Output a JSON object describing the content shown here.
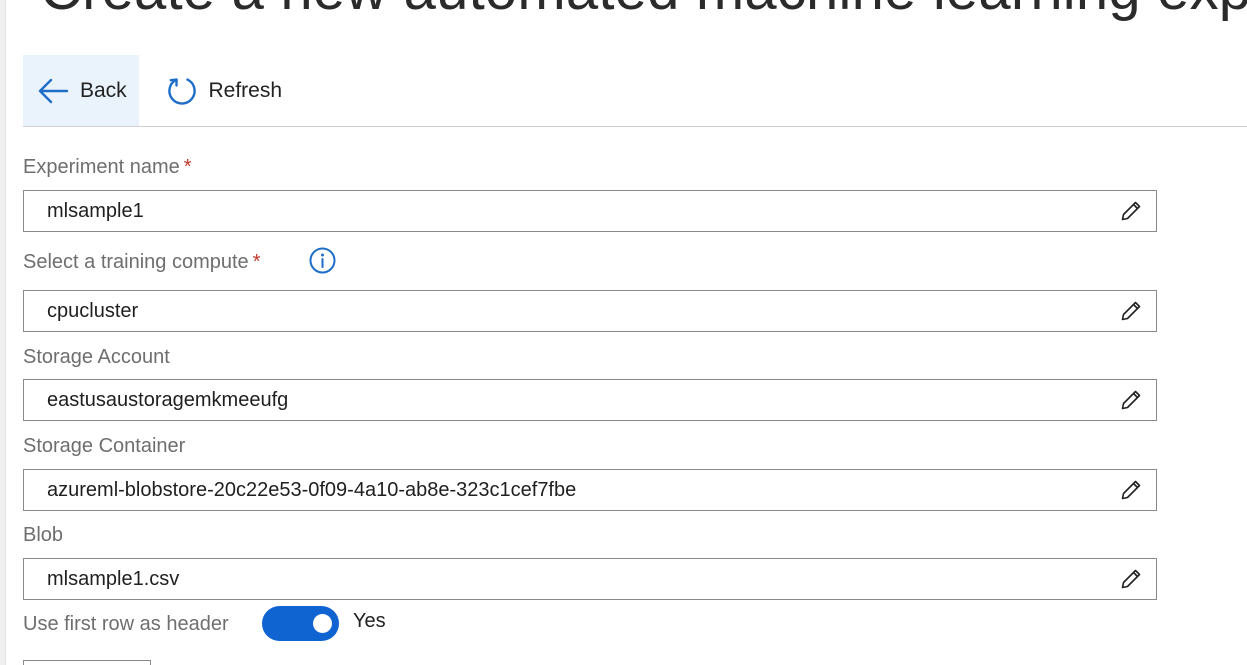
{
  "page_title": "Create a new automated machine learning experiment",
  "toolbar": {
    "back_label": "Back",
    "refresh_label": "Refresh"
  },
  "fields": {
    "experiment_name": {
      "label": "Experiment name",
      "required_mark": "*",
      "value": "mlsample1"
    },
    "training_compute": {
      "label": "Select a training compute",
      "required_mark": "*",
      "value": "cpucluster"
    },
    "storage_account": {
      "label": "Storage Account",
      "value": "eastusaustoragemkmeeufg"
    },
    "storage_container": {
      "label": "Storage Container",
      "value": "azureml-blobstore-20c22e53-0f09-4a10-ab8e-323c1cef7fbe"
    },
    "blob": {
      "label": "Blob",
      "value": "mlsample1.csv"
    }
  },
  "header_toggle": {
    "label": "Use first row as header",
    "state": "Yes",
    "on": true
  },
  "icons": {
    "back": "arrow-left-icon",
    "refresh": "refresh-icon",
    "info": "info-icon",
    "edit": "pencil-icon"
  },
  "colors": {
    "accent": "#0f64d2",
    "icon_blue": "#1e6ec8",
    "required": "#c0392b",
    "back_hover_bg": "#eaf3fb"
  }
}
